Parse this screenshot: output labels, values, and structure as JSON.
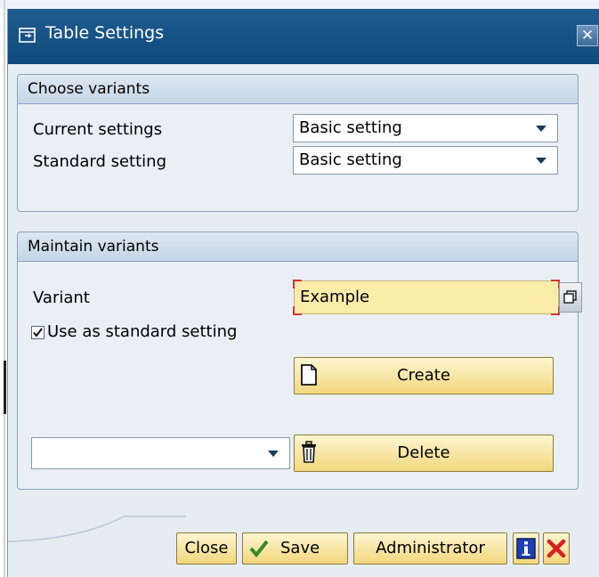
{
  "window": {
    "title": "Table Settings"
  },
  "choose_variants": {
    "header": "Choose variants",
    "current_settings": {
      "label": "Current settings",
      "value": "Basic setting"
    },
    "standard_setting": {
      "label": "Standard setting",
      "value": "Basic setting"
    }
  },
  "maintain_variants": {
    "header": "Maintain variants",
    "variant": {
      "label": "Variant",
      "value": "Example"
    },
    "use_as_standard": {
      "label": "Use as standard setting",
      "checked": true
    },
    "create_label": "Create",
    "delete_dropdown_value": "",
    "delete_label": "Delete"
  },
  "footer": {
    "close_label": "Close",
    "save_label": "Save",
    "administrator_label": "Administrator"
  },
  "colors": {
    "title_bar": "#1f5c8f",
    "button_yellow": "#f3d77c",
    "required_marker": "#d2353a",
    "panel": "#e6edf2"
  },
  "icons": [
    "window-icon",
    "close-icon",
    "dropdown-icon",
    "f4-help-icon",
    "checkmark-icon",
    "document-icon",
    "trash-icon",
    "save-check-icon",
    "info-icon",
    "cancel-icon"
  ]
}
